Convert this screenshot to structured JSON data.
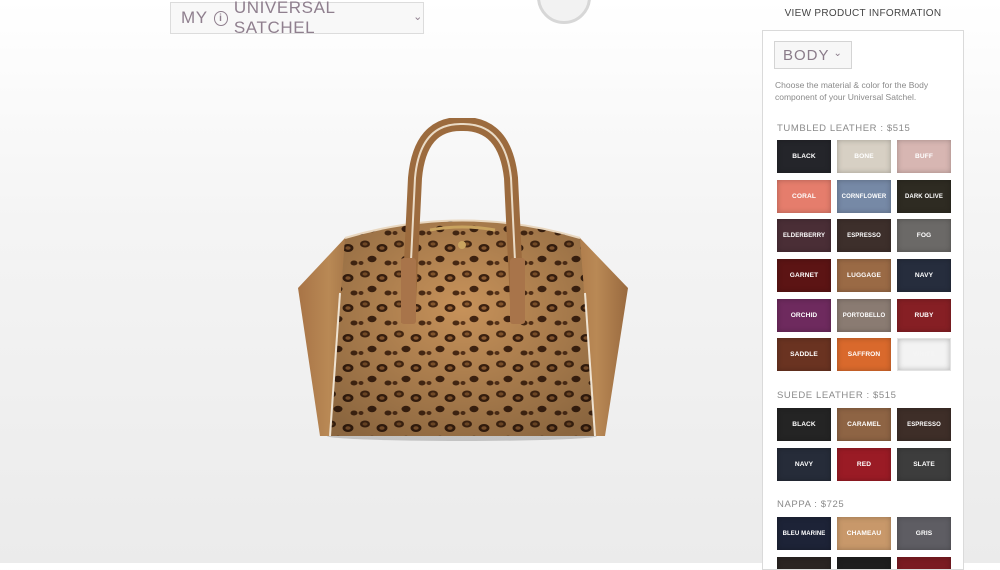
{
  "header": {
    "title": "MY",
    "product_name": "UNIVERSAL SATCHEL",
    "view_info_link": "VIEW PRODUCT INFORMATION"
  },
  "panel": {
    "component": "BODY",
    "description": "Choose the material & color for the Body component of your Universal Satchel.",
    "sections": [
      {
        "title": "TUMBLED LEATHER : $515",
        "swatches": [
          {
            "label": "BLACK",
            "color": "#24252a"
          },
          {
            "label": "BONE",
            "color": "#d7d0c4"
          },
          {
            "label": "BUFF",
            "color": "#d7b6b2"
          },
          {
            "label": "CORAL",
            "color": "#e57d6c"
          },
          {
            "label": "CORNFLOWER",
            "color": "#7689a6"
          },
          {
            "label": "DARK OLIVE",
            "color": "#2e2b22"
          },
          {
            "label": "ELDERBERRY",
            "color": "#4a2e36"
          },
          {
            "label": "ESPRESSO",
            "color": "#3d2f2b"
          },
          {
            "label": "FOG",
            "color": "#6b6967"
          },
          {
            "label": "GARNET",
            "color": "#5c1414"
          },
          {
            "label": "LUGGAGE",
            "color": "#9a6a45"
          },
          {
            "label": "NAVY",
            "color": "#262d3d"
          },
          {
            "label": "ORCHID",
            "color": "#6e2a5e"
          },
          {
            "label": "PORTOBELLO",
            "color": "#8a7b72"
          },
          {
            "label": "RUBY",
            "color": "#861f24"
          },
          {
            "label": "SADDLE",
            "color": "#6a3321"
          },
          {
            "label": "SAFFRON",
            "color": "#d9692c"
          },
          {
            "label": "WHITE",
            "color": "#f3f3f3"
          }
        ]
      },
      {
        "title": "SUEDE LEATHER : $515",
        "swatches": [
          {
            "label": "BLACK",
            "color": "#242424"
          },
          {
            "label": "CARAMEL",
            "color": "#8e6444"
          },
          {
            "label": "ESPRESSO",
            "color": "#3e2e28"
          },
          {
            "label": "NAVY",
            "color": "#262c39"
          },
          {
            "label": "RED",
            "color": "#9a1b25"
          },
          {
            "label": "SLATE",
            "color": "#3d3d3d"
          }
        ]
      },
      {
        "title": "NAPPA : $725",
        "swatches": [
          {
            "label": "BLEU MARINE",
            "color": "#1d2337"
          },
          {
            "label": "CHAMEAU",
            "color": "#c8986a"
          },
          {
            "label": "GRIS",
            "color": "#5e5d63"
          },
          {
            "label": "",
            "color": "#2a2422"
          },
          {
            "label": "",
            "color": "#1e1e1e"
          },
          {
            "label": "",
            "color": "#7a1b22"
          }
        ]
      }
    ]
  },
  "colors": {
    "accent": "#8f7f8e",
    "leather": "#b07c4b",
    "panel_bg": "#ffffff"
  }
}
